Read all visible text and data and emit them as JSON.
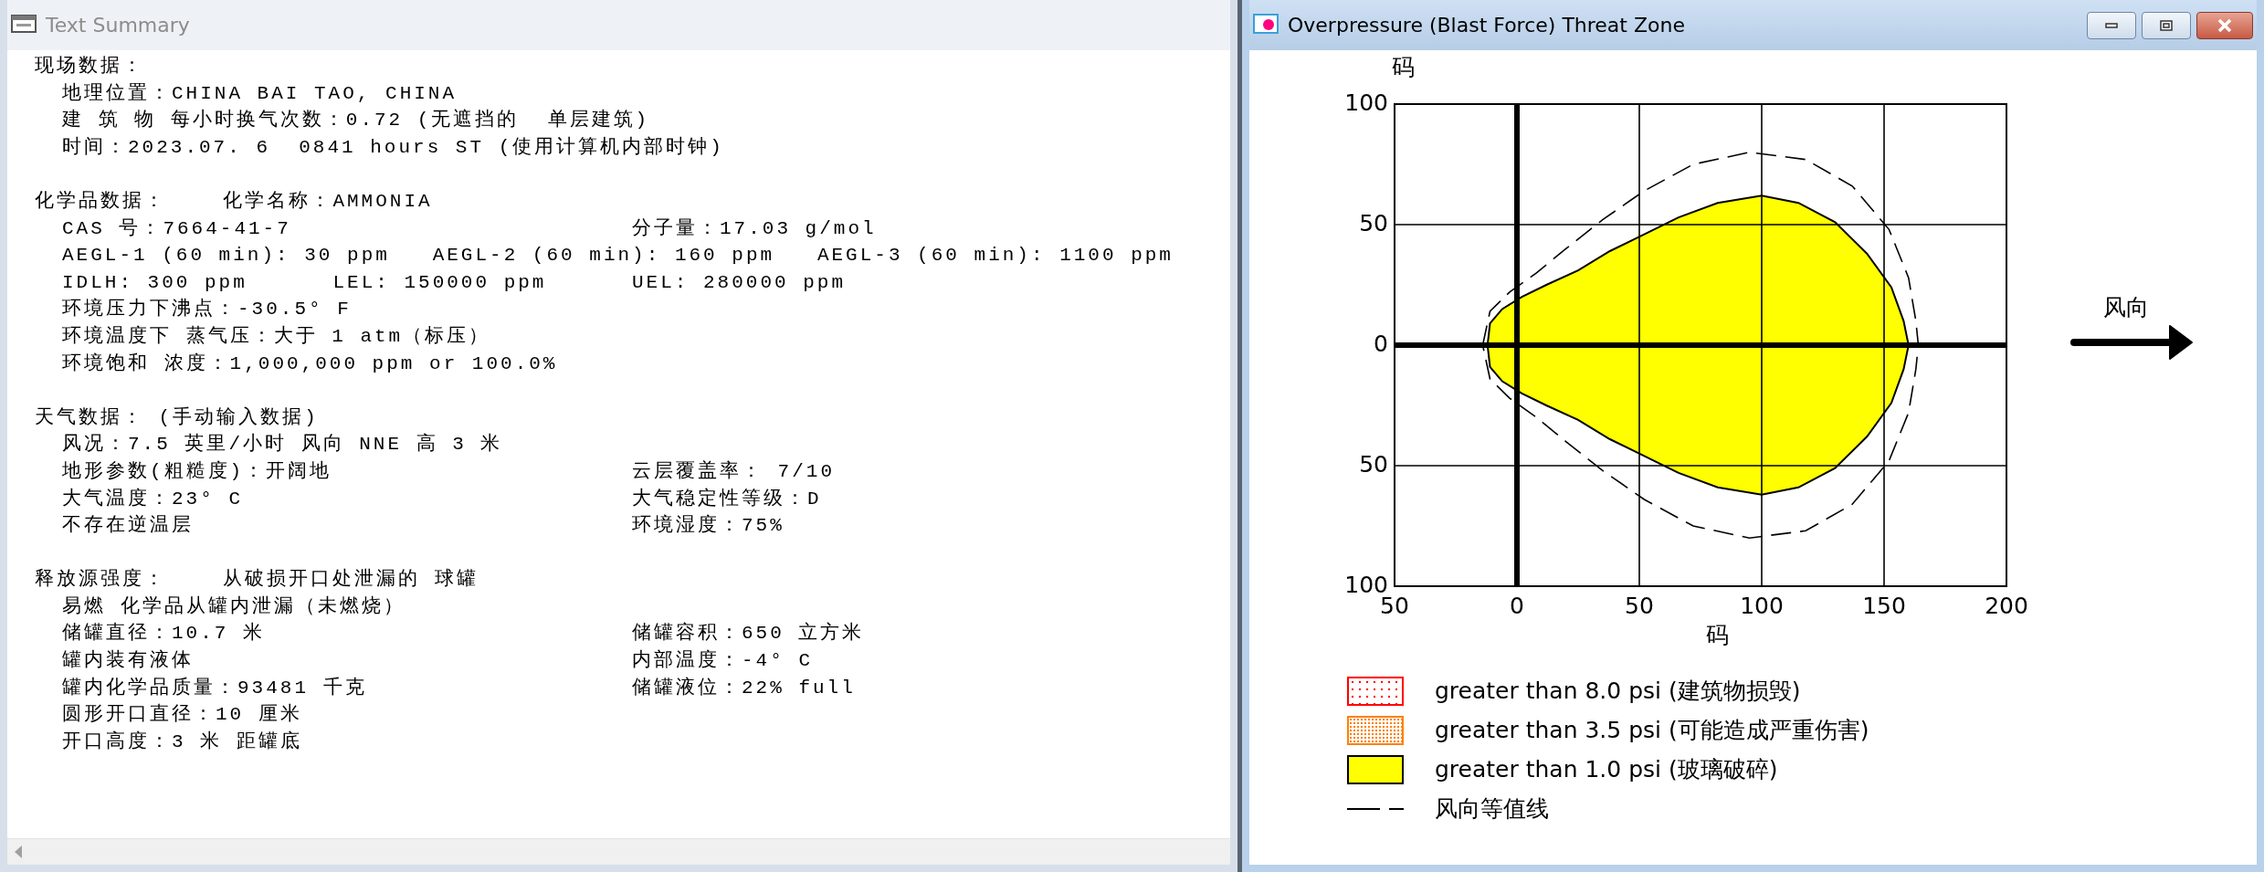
{
  "text_summary": {
    "title": "Text Summary",
    "active": false,
    "sections": [
      {
        "heading": "现场数据：",
        "lines": [
          {
            "text": "地理位置：CHINA BAI TAO, CHINA"
          },
          {
            "text": "建 筑 物 每小时换气次数：0.72 (无遮挡的  单层建筑)"
          },
          {
            "text": "时间：2023.07. 6  0841 hours ST (使用计算机内部时钟)"
          }
        ]
      },
      {
        "heading": "化学品数据：    化学名称：AMMONIA",
        "lines": [
          {
            "text": "CAS 号：7664-41-7",
            "right": "分子量：17.03 g/mol"
          },
          {
            "text": "AEGL-1 (60 min): 30 ppm   AEGL-2 (60 min): 160 ppm   AEGL-3 (60 min): 1100 ppm"
          },
          {
            "text": "IDLH: 300 ppm      LEL: 150000 ppm",
            "right": "UEL: 280000 ppm"
          },
          {
            "text": "环境压力下沸点：-30.5° F"
          },
          {
            "text": "环境温度下 蒸气压：大于 1 atm（标压）"
          },
          {
            "text": "环境饱和 浓度：1,000,000 ppm or 100.0%"
          }
        ]
      },
      {
        "heading": "天气数据： (手动输入数据)",
        "lines": [
          {
            "text": "风况：7.5 英里/小时 风向 NNE 高 3 米"
          },
          {
            "text": "地形参数(粗糙度)：开阔地",
            "right": "云层覆盖率： 7/10"
          },
          {
            "text": "大气温度：23° C",
            "right": "大气稳定性等级：D"
          },
          {
            "text": "不存在逆温层",
            "right": "环境湿度：75%"
          }
        ]
      },
      {
        "heading": "释放源强度：    从破损开口处泄漏的 球罐",
        "lines": [
          {
            "text": "易燃 化学品从罐内泄漏（未燃烧）"
          },
          {
            "text": "储罐直径：10.7 米",
            "right": "储罐容积：650 立方米"
          },
          {
            "text": "罐内装有液体",
            "right": "内部温度：-4° C"
          },
          {
            "text": "罐内化学品质量：93481 千克",
            "right": "储罐液位：22% full"
          },
          {
            "text": "圆形开口直径：10 厘米"
          },
          {
            "text": "开口高度：3 米 距罐底"
          }
        ]
      }
    ]
  },
  "threat_zone": {
    "title": "Overpressure (Blast Force) Threat Zone",
    "active": true,
    "y_axis_label": "码",
    "x_axis_label": "码",
    "y_ticks": [
      "100",
      "50",
      "0",
      "50",
      "100"
    ],
    "x_ticks": [
      "50",
      "0",
      "50",
      "100",
      "150",
      "200"
    ],
    "wind_label": "风向",
    "legend": [
      {
        "kind": "dotted",
        "color": "#ff0000",
        "label": "greater than 8.0 psi (建筑物损毁)"
      },
      {
        "kind": "dotted",
        "color": "#ff8000",
        "label": "greater than 3.5 psi (可能造成严重伤害)"
      },
      {
        "kind": "solid",
        "color": "#ffff00",
        "label": "greater than 1.0 psi (玻璃破碎)"
      },
      {
        "kind": "dashed",
        "label": "风向等值线"
      }
    ]
  }
}
